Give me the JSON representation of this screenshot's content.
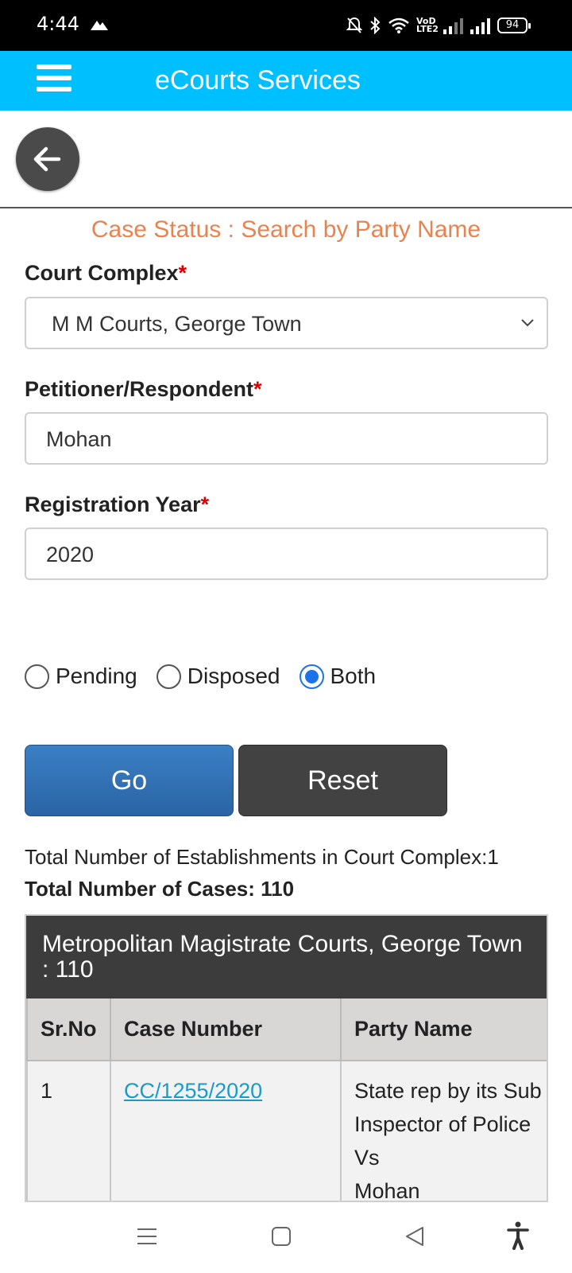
{
  "status_bar": {
    "time": "4:44",
    "network_label": "VoD LTE2",
    "battery": "94"
  },
  "app": {
    "title": "eCourts Services",
    "accent_color": "#00bfff"
  },
  "page": {
    "heading": "Case Status : Search by Party Name",
    "heading_color": "#e8834f"
  },
  "form": {
    "court_complex": {
      "label": "Court Complex",
      "required_mark": "*",
      "value": "M M Courts, George Town"
    },
    "party": {
      "label": "Petitioner/Respondent",
      "required_mark": "*",
      "value": "Mohan"
    },
    "year": {
      "label": "Registration Year",
      "required_mark": "*",
      "value": "2020"
    },
    "status_options": [
      {
        "label": "Pending",
        "checked": false
      },
      {
        "label": "Disposed",
        "checked": false
      },
      {
        "label": "Both",
        "checked": true
      }
    ],
    "go_label": "Go",
    "reset_label": "Reset"
  },
  "summary": {
    "establishments": "Total Number of Establishments in Court Complex:1",
    "total_cases": "Total Number of Cases: 110"
  },
  "results": {
    "establishment_heading": "Metropolitan Magistrate Courts, George Town : 110",
    "columns": [
      "Sr.No",
      "Case Number",
      "Party Name"
    ],
    "rows": [
      {
        "sr_no": "1",
        "case_number": "CC/1255/2020",
        "party_line1": "State rep by its Sub",
        "party_line2": "Inspector of Police",
        "party_line3": "Vs",
        "party_line4": "Mohan"
      }
    ]
  },
  "nav": {
    "icons": [
      "menu-icon",
      "home-square-icon",
      "back-triangle-icon",
      "accessibility-icon"
    ]
  }
}
